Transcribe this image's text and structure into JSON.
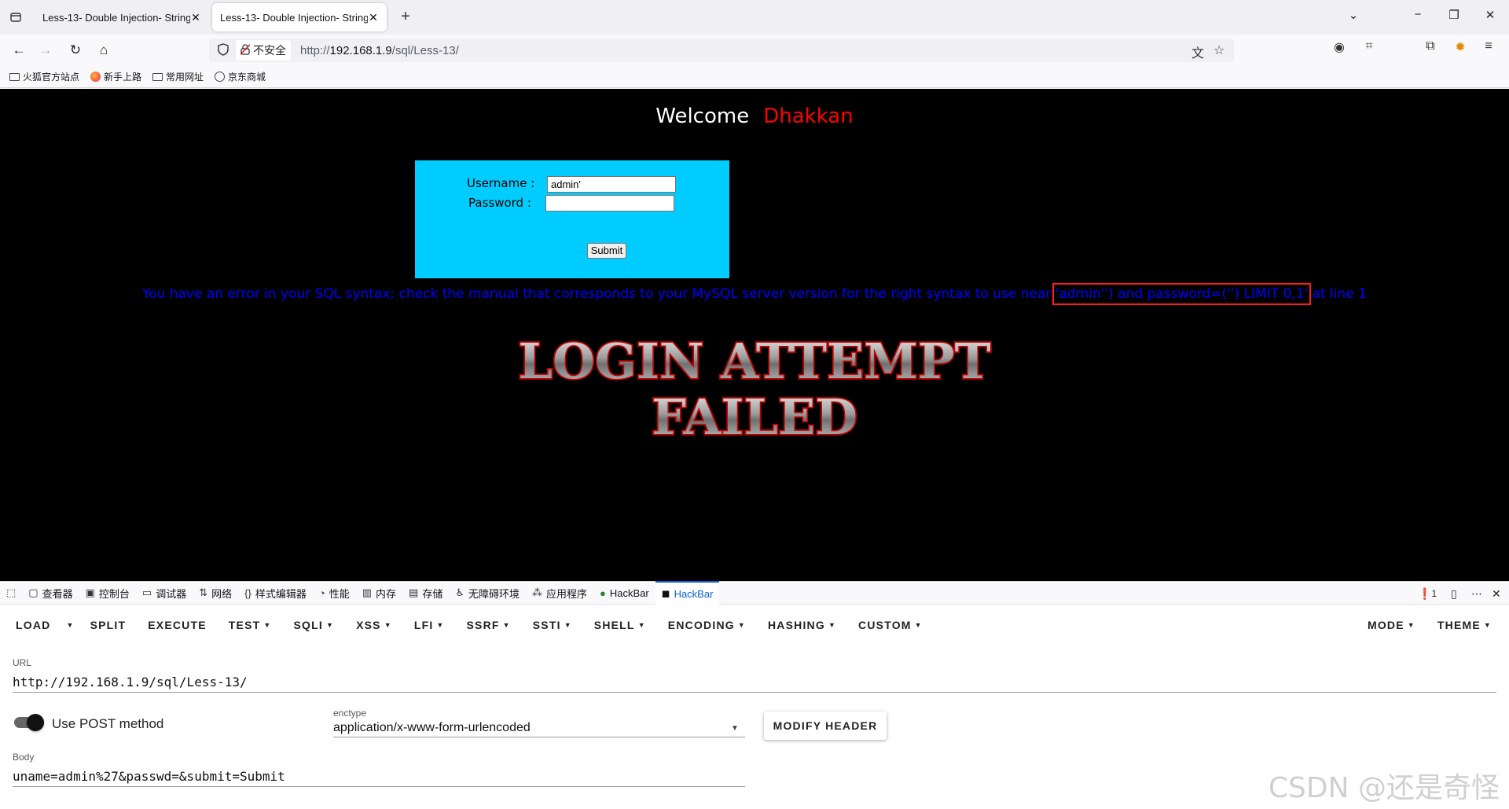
{
  "browser": {
    "tabs": [
      {
        "label": "Less-13- Double Injection- String"
      },
      {
        "label": "Less-13- Double Injection- String"
      }
    ],
    "url_security": "不安全",
    "url_prefix": "http://",
    "url_host": "192.168.1.9",
    "url_path": "/sql/Less-13/",
    "bookmarks": [
      {
        "label": "火狐官方站点",
        "icon": "folder-icon"
      },
      {
        "label": "新手上路",
        "icon": "firefox-icon"
      },
      {
        "label": "常用网址",
        "icon": "folder-icon"
      },
      {
        "label": "京东商城",
        "icon": "globe-icon"
      }
    ]
  },
  "page": {
    "welcome": "Welcome",
    "user_name": "Dhakkan",
    "username_label": "Username :",
    "username_value": "admin'",
    "password_label": "Password :",
    "password_value": "",
    "submit_label": "Submit",
    "error_prefix": "You have an error in your SQL syntax; check the manual that corresponds to your MySQL server version for the right syntax to use near ",
    "error_highlight": "'admin'') and password=('') LIMIT 0,1'",
    "error_suffix": " at line 1",
    "failed_line1": "LOGIN ATTEMPT",
    "failed_line2": "FAILED",
    "colors": {
      "background": "#000000",
      "login_box": "#00ccff",
      "error_text": "#0000ff",
      "name": "#ff0000"
    }
  },
  "devtools": {
    "tabs": [
      {
        "label": "查看器",
        "icon": "inspector-icon"
      },
      {
        "label": "控制台",
        "icon": "console-icon"
      },
      {
        "label": "调试器",
        "icon": "debugger-icon"
      },
      {
        "label": "网络",
        "icon": "network-icon"
      },
      {
        "label": "样式编辑器",
        "icon": "style-editor-icon"
      },
      {
        "label": "性能",
        "icon": "performance-icon"
      },
      {
        "label": "内存",
        "icon": "memory-icon"
      },
      {
        "label": "存储",
        "icon": "storage-icon"
      },
      {
        "label": "无障碍环境",
        "icon": "accessibility-icon"
      },
      {
        "label": "应用程序",
        "icon": "application-icon"
      },
      {
        "label": "HackBar",
        "icon": "hackbar-green-icon"
      },
      {
        "label": "HackBar",
        "icon": "hackbar-icon"
      }
    ],
    "error_count": "1"
  },
  "hackbar": {
    "menu": [
      "LOAD",
      "SPLIT",
      "EXECUTE",
      "TEST",
      "SQLI",
      "XSS",
      "LFI",
      "SSRF",
      "SSTI",
      "SHELL",
      "ENCODING",
      "HASHING",
      "CUSTOM"
    ],
    "menu_right": [
      "MODE",
      "THEME"
    ],
    "url_label": "URL",
    "url_value": "http://192.168.1.9/sql/Less-13/",
    "post_label": "Use POST method",
    "enctype_label": "enctype",
    "enctype_value": "application/x-www-form-urlencoded",
    "modify_header": "MODIFY HEADER",
    "body_label": "Body",
    "body_value": "uname=admin%27&passwd=&submit=Submit"
  },
  "watermark": "CSDN @还是奇怪"
}
